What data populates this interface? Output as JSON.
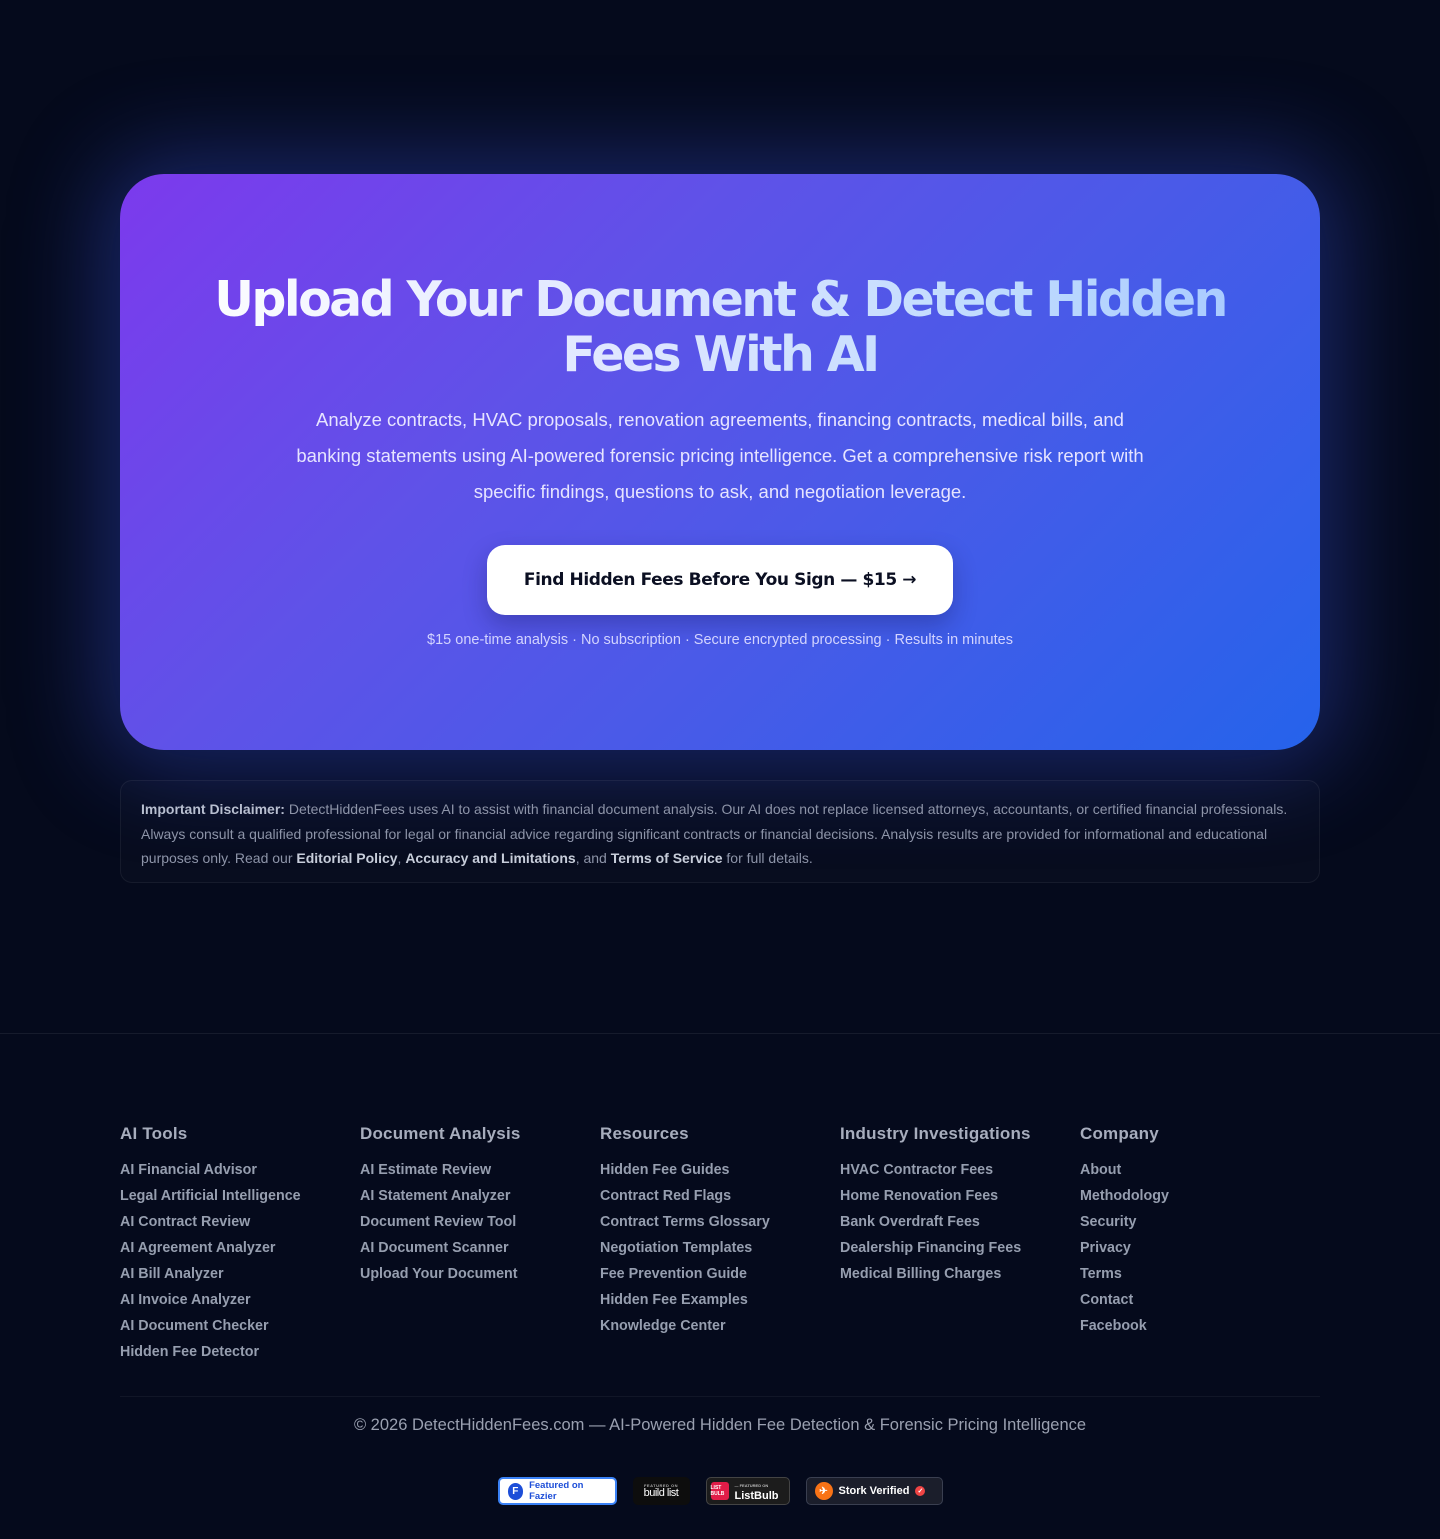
{
  "hero": {
    "title": "Upload Your Document & Detect Hidden Fees With AI",
    "subtitle": "Analyze contracts, HVAC proposals, renovation agreements, financing contracts, medical bills, and banking statements using AI-powered forensic pricing intelligence. Get a comprehensive risk report with specific findings, questions to ask, and negotiation leverage.",
    "cta_label": "Find Hidden Fees Before You Sign — $15 →",
    "fine_print": "$15 one-time analysis · No subscription · Secure encrypted processing · Results in minutes"
  },
  "disclaimer": {
    "heading": "Important Disclaimer:",
    "body": " DetectHiddenFees uses AI to assist with financial document analysis. Our AI does not replace licensed attorneys, accountants, or certified financial professionals. Always consult a qualified professional for legal or financial advice regarding significant contracts or financial decisions. Analysis results are provided for informational and educational purposes only. Read our ",
    "link_editorial": "Editorial Policy",
    "sep1": ", ",
    "link_accuracy": "Accuracy and Limitations",
    "sep2": ", and ",
    "link_terms": "Terms of Service",
    "tail": " for full details."
  },
  "footer": {
    "columns": [
      {
        "title": "AI Tools",
        "links": [
          "AI Financial Advisor",
          "Legal Artificial Intelligence",
          "AI Contract Review",
          "AI Agreement Analyzer",
          "AI Bill Analyzer",
          "AI Invoice Analyzer",
          "AI Document Checker",
          "Hidden Fee Detector"
        ]
      },
      {
        "title": "Document Analysis",
        "links": [
          "AI Estimate Review",
          "AI Statement Analyzer",
          "Document Review Tool",
          "AI Document Scanner",
          "Upload Your Document"
        ]
      },
      {
        "title": "Resources",
        "links": [
          "Hidden Fee Guides",
          "Contract Red Flags",
          "Contract Terms Glossary",
          "Negotiation Templates",
          "Fee Prevention Guide",
          "Hidden Fee Examples",
          "Knowledge Center"
        ]
      },
      {
        "title": "Industry Investigations",
        "links": [
          "HVAC Contractor Fees",
          "Home Renovation Fees",
          "Bank Overdraft Fees",
          "Dealership Financing Fees",
          "Medical Billing Charges"
        ]
      },
      {
        "title": "Company",
        "links": [
          "About",
          "Methodology",
          "Security",
          "Privacy",
          "Terms",
          "Contact",
          "Facebook"
        ]
      }
    ],
    "copyright": "© 2026 DetectHiddenFees.com — AI-Powered Hidden Fee Detection & Forensic Pricing Intelligence",
    "badges": {
      "fazier": "Featured on Fazier",
      "fazier_mark": "F",
      "buildlist_small": "FEATURED ON",
      "buildlist_big": "build list",
      "listbulb_mark": "LIST BULB",
      "listbulb_small": "— FEATURED ON",
      "listbulb_big": "ListBulb",
      "stork": "Stork Verified",
      "stork_mark": "✈",
      "stork_check": "✓"
    }
  }
}
